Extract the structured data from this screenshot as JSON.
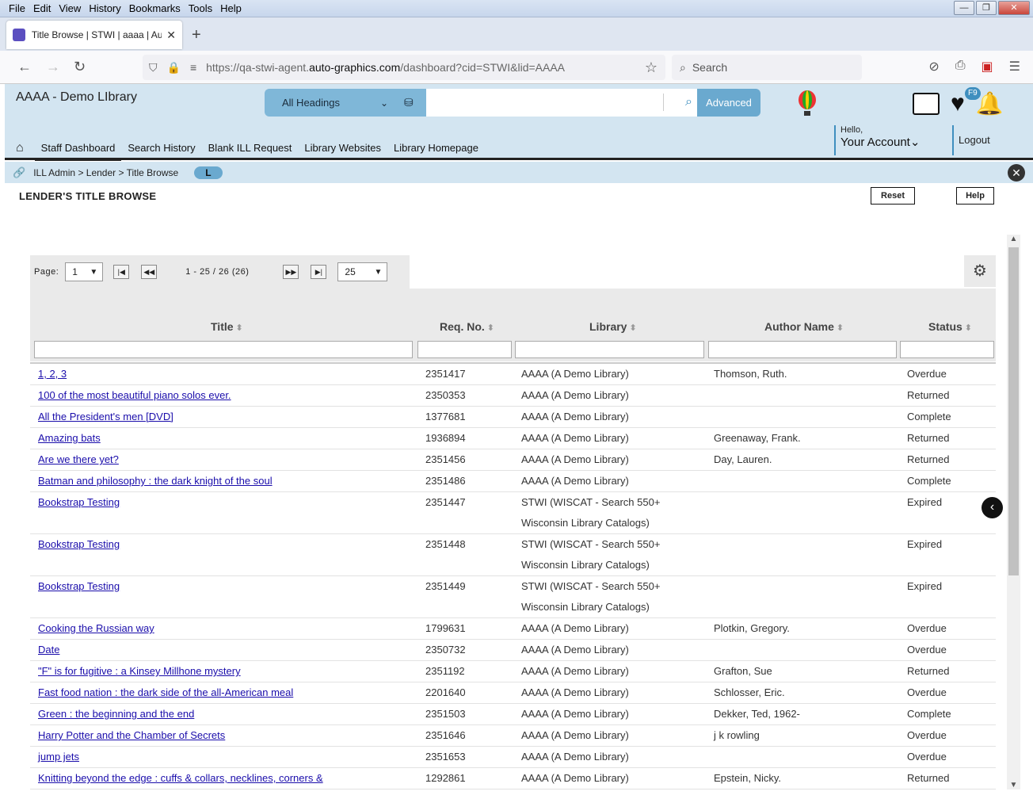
{
  "menubar": [
    "File",
    "Edit",
    "View",
    "History",
    "Bookmarks",
    "Tools",
    "Help"
  ],
  "tab": {
    "title": "Title Browse | STWI | aaaa | Auto",
    "close": "✕",
    "new": "+"
  },
  "url": {
    "prefix": "https://qa-stwi-agent.",
    "domain": "auto-graphics.com",
    "suffix": "/dashboard?cid=STWI&lid=AAAA"
  },
  "browser_search": {
    "placeholder": "Search"
  },
  "app": {
    "library_name": "AAAA - Demo LIbrary",
    "heading_select": "All Headings",
    "advanced_label": "Advanced",
    "badge_f9": "F9",
    "nav": [
      "Staff Dashboard",
      "Search History",
      "Blank ILL Request",
      "Library Websites",
      "Library Homepage"
    ],
    "hello": "Hello,",
    "account": "Your Account",
    "logout": "Logout"
  },
  "breadcrumb": {
    "path": "ILL Admin > Lender > Title Browse",
    "pill": "L"
  },
  "page": {
    "title": "LENDER'S TITLE BROWSE",
    "reset": "Reset",
    "help": "Help"
  },
  "pager": {
    "label": "Page:",
    "page": "1",
    "range": "1 - 25 / 26 (26)",
    "per_page": "25"
  },
  "columns": [
    "Title",
    "Req. No.",
    "Library",
    "Author Name",
    "Status"
  ],
  "rows": [
    {
      "title": "1, 2, 3 ",
      "req": "2351417",
      "lib": "AAAA (A Demo Library)",
      "author": "Thomson, Ruth.",
      "status": "Overdue"
    },
    {
      "title": "100 of the most beautiful piano solos ever. ",
      "req": "2350353",
      "lib": "AAAA (A Demo Library)",
      "author": "",
      "status": "Returned"
    },
    {
      "title": "All the President's men [DVD] ",
      "req": "1377681",
      "lib": "AAAA (A Demo Library)",
      "author": "",
      "status": "Complete"
    },
    {
      "title": "Amazing bats ",
      "req": "1936894",
      "lib": "AAAA (A Demo Library)",
      "author": "Greenaway, Frank.",
      "status": "Returned"
    },
    {
      "title": "Are we there yet? ",
      "req": "2351456",
      "lib": "AAAA (A Demo Library)",
      "author": "Day, Lauren.",
      "status": "Returned"
    },
    {
      "title": "Batman and philosophy : the dark knight of the soul ",
      "req": "2351486",
      "lib": "AAAA (A Demo Library)",
      "author": "",
      "status": "Complete"
    },
    {
      "title": "Bookstrap Testing ",
      "req": "2351447",
      "lib": "STWI (WISCAT - Search 550+ Wisconsin Library Catalogs)",
      "author": "",
      "status": "Expired"
    },
    {
      "title": "Bookstrap Testing ",
      "req": "2351448",
      "lib": "STWI (WISCAT - Search 550+ Wisconsin Library Catalogs)",
      "author": "",
      "status": "Expired"
    },
    {
      "title": "Bookstrap Testing ",
      "req": "2351449",
      "lib": "STWI (WISCAT - Search 550+ Wisconsin Library Catalogs)",
      "author": "",
      "status": "Expired"
    },
    {
      "title": "Cooking the Russian way ",
      "req": "1799631",
      "lib": "AAAA (A Demo Library)",
      "author": "Plotkin, Gregory.",
      "status": "Overdue"
    },
    {
      "title": "Date ",
      "req": "2350732",
      "lib": "AAAA (A Demo Library)",
      "author": "",
      "status": "Overdue"
    },
    {
      "title": "\"F\" is for fugitive : a Kinsey Millhone mystery ",
      "req": "2351192",
      "lib": "AAAA (A Demo Library)",
      "author": "Grafton, Sue",
      "status": "Returned"
    },
    {
      "title": "Fast food nation : the dark side of the all-American meal ",
      "req": "2201640",
      "lib": "AAAA (A Demo Library)",
      "author": "Schlosser, Eric.",
      "status": "Overdue"
    },
    {
      "title": "Green : the beginning and the end ",
      "req": "2351503",
      "lib": "AAAA (A Demo Library)",
      "author": "Dekker, Ted, 1962-",
      "status": "Complete"
    },
    {
      "title": "Harry Potter and the Chamber of Secrets ",
      "req": "2351646",
      "lib": "AAAA (A Demo Library)",
      "author": "j k rowling",
      "status": "Overdue"
    },
    {
      "title": "jump jets ",
      "req": "2351653",
      "lib": "AAAA (A Demo Library)",
      "author": "",
      "status": "Overdue"
    },
    {
      "title": "Knitting beyond the edge : cuffs & collars, necklines, corners &",
      "req": "1292861",
      "lib": "AAAA (A Demo Library)",
      "author": "Epstein, Nicky.",
      "status": "Returned"
    }
  ]
}
